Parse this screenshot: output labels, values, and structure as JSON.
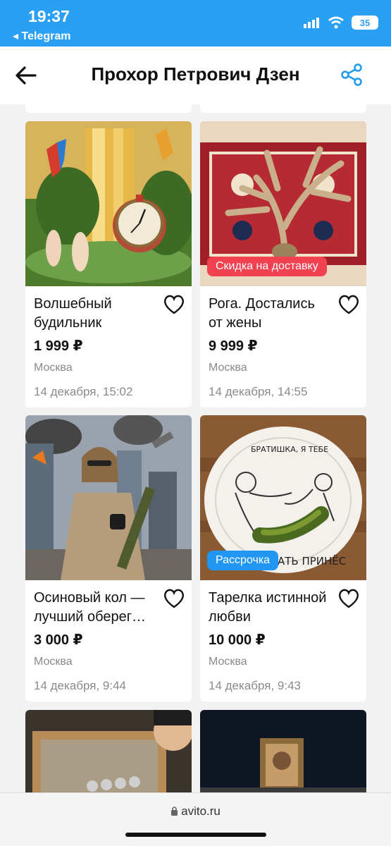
{
  "status_bar": {
    "time": "19:37",
    "back_app": "Telegram",
    "battery": "35"
  },
  "header": {
    "title": "Прохор Петрович Дзен"
  },
  "listings": [
    {
      "title": "Волшебный будильник",
      "price": "1 999 ₽",
      "city": "Москва",
      "date": "14 декабря, 15:02",
      "badge": ""
    },
    {
      "title": "Рога. Достались от жены",
      "price": "9 999 ₽",
      "city": "Москва",
      "date": "14 декабря, 14:55",
      "badge": "Скидка на доставку"
    },
    {
      "title": "Осиновый кол — лучший оберег…",
      "price": "3 000 ₽",
      "city": "Москва",
      "date": "14 декабря, 9:44",
      "badge": ""
    },
    {
      "title": "Тарелка истинной любви",
      "price": "10 000 ₽",
      "city": "Москва",
      "date": "14 декабря, 9:43",
      "badge": "Рассрочка"
    }
  ],
  "plate_text": {
    "top": "БРАТИШКА, Я ТЕБЕ",
    "bottom": "АТЬ ПРИНЁС"
  },
  "browser": {
    "url": "avito.ru"
  },
  "colors": {
    "telegram_blue": "#2aa0f5",
    "share_blue": "#1e9be9",
    "badge_red": "#f24150",
    "badge_blue": "#2196f3"
  }
}
